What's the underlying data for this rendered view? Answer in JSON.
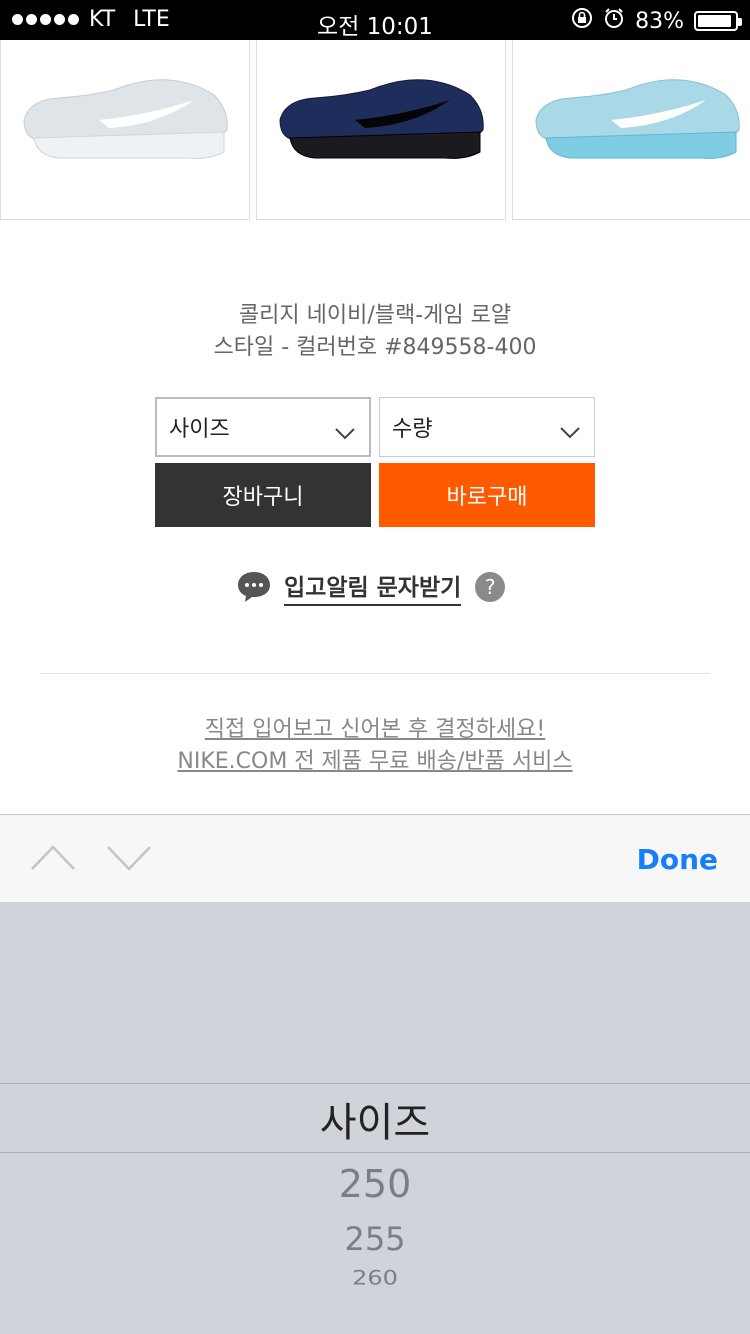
{
  "status_bar": {
    "carrier": "KT",
    "network": "LTE",
    "time": "오전 10:01",
    "battery": "83%",
    "battery_level": 0.83
  },
  "product": {
    "color_name": "콜리지 네이비/블랙-게임 로얄",
    "style_line": "스타일 - 컬러번호 #849558-400"
  },
  "selects": {
    "size_label": "사이즈",
    "quantity_label": "수량"
  },
  "buttons": {
    "cart": "장바구니",
    "buy_now": "바로구매"
  },
  "notify": {
    "label": "입고알림 문자받기",
    "help": "?"
  },
  "promo": {
    "line1": "직접 입어보고 신어본 후 결정하세요!",
    "line2": "NIKE.COM 전 제품 무료 배송/반품 서비스"
  },
  "accessory": {
    "done": "Done"
  },
  "picker": {
    "selected": "사이즈",
    "options": [
      "250",
      "255",
      "260"
    ]
  },
  "colors": {
    "cart_button": "#333333",
    "buy_button": "#ff5a00",
    "done_blue": "#157efb",
    "picker_bg": "#d0d4da"
  }
}
